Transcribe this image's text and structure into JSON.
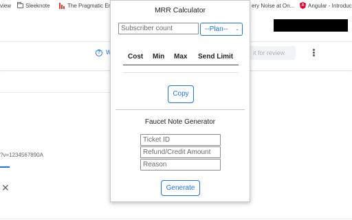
{
  "bookmarks": [
    {
      "icon": "page-icon",
      "label": "view"
    },
    {
      "icon": "folder-icon",
      "label": "Sleeknote"
    },
    {
      "icon": "pragmatic-bars-icon",
      "label": "The Pragmatic En"
    },
    {
      "icon": "page-icon",
      "label": "ery Noise at On..."
    },
    {
      "icon": "angular-icon",
      "label": "Angular - Introduc"
    }
  ],
  "background": {
    "help_partial": "W",
    "submit_partial": "it for review",
    "url_fragment": "?v=1234567890A",
    "close_glyph": "✕"
  },
  "popup": {
    "title": "MRR Calculator",
    "subscriber_placeholder": "Subscriber count",
    "plan_selected": "--Plan--",
    "table_headers": [
      "Cost",
      "Min",
      "Max",
      "Send Limit"
    ],
    "copy_label": "Copy",
    "faucet_title": "Faucet Note Generator",
    "ticket_placeholder": "Ticket ID",
    "amount_placeholder": "Refund/Credit Amount",
    "reason_placeholder": "Reason",
    "generate_label": "Generate"
  },
  "colors": {
    "accent": "#1a73e8",
    "redaction": "#000000"
  }
}
